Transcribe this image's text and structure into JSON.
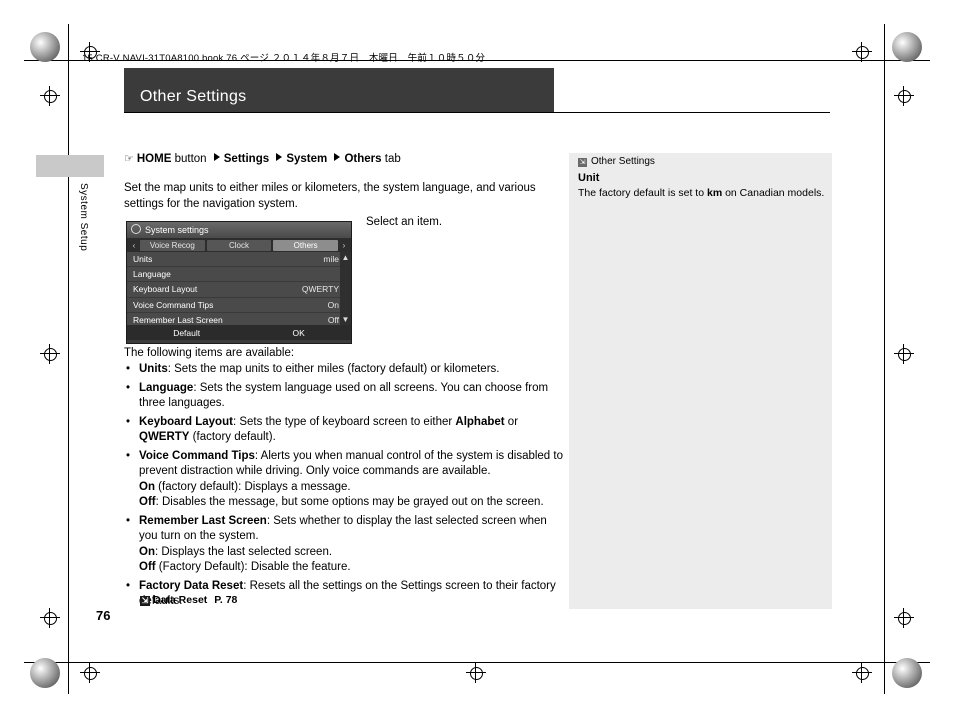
{
  "printer_line": "15 CR-V NAVI-31T0A8100.book  76 ページ  ２０１４年８月７日　木曜日　午前１０時５０分",
  "header": {
    "title": "Other Settings"
  },
  "side_tab_label": "System Setup",
  "breadcrumb": {
    "icon": "hand-pointer-icon",
    "home": "HOME",
    "button_word": "button",
    "settings": "Settings",
    "system": "System",
    "others": "Others",
    "tab_word": "tab"
  },
  "intro": "Set the map units to either miles or kilometers, the system language, and various settings for the navigation system.",
  "select_item_caption": "Select an item.",
  "device": {
    "title": "System settings",
    "tabs": [
      "Voice Recog",
      "Clock",
      "Others"
    ],
    "active_tab": "Others",
    "left_chevron": "‹",
    "right_chevron": "›",
    "rows": [
      {
        "label": "Units",
        "value": "mile"
      },
      {
        "label": "Language",
        "value": ""
      },
      {
        "label": "Keyboard Layout",
        "value": "QWERTY"
      },
      {
        "label": "Voice Command Tips",
        "value": "On"
      },
      {
        "label": "Remember Last Screen",
        "value": "Off"
      }
    ],
    "scroll_up": "▲",
    "scroll_down": "▼",
    "footer": [
      "Default",
      "OK"
    ]
  },
  "available_intro": "The following items are available:",
  "bullets": [
    {
      "id": "units",
      "html": "<b>Units</b>: Sets the map units to either miles (factory default) or kilometers.",
      "sub": []
    },
    {
      "id": "language",
      "html": "<b>Language</b>: Sets the system language used on all screens. You can choose from three languages.",
      "sub": []
    },
    {
      "id": "keyboard-layout",
      "html": "<b>Keyboard Layout</b>: Sets the type of keyboard screen to either <b>Alphabet</b> or <b>QWERTY</b> (factory default).",
      "sub": []
    },
    {
      "id": "voice-command-tips",
      "html": "<b>Voice Command Tips</b>: Alerts you when manual control of the system is disabled to prevent distraction while driving. Only voice commands are available.",
      "sub": [
        "<b>On</b> (factory default): Displays a message.",
        "<b>Off</b>: Disables the message, but some options may be grayed out on the screen."
      ]
    },
    {
      "id": "remember-last-screen",
      "html": "<b>Remember Last Screen</b>: Sets whether to display the last selected screen when you turn on the system.",
      "sub": [
        "<b>On</b>: Displays the last selected screen.",
        "<b>Off</b> (Factory Default): Disable the feature."
      ]
    },
    {
      "id": "factory-data-reset",
      "html": "<b>Factory Data Reset</b>: Resets all the settings on the Settings screen to their factory defaults.",
      "sub": []
    }
  ],
  "reference": {
    "icon": "book-reference-icon",
    "label": "Data Reset",
    "page": "P. 78"
  },
  "page_number": "76",
  "sidebox": {
    "icon": "note-icon",
    "title": "Other Settings",
    "heading": "Unit",
    "body_prefix": "The factory default is set to ",
    "body_bold": "km",
    "body_suffix": " on Canadian models."
  }
}
